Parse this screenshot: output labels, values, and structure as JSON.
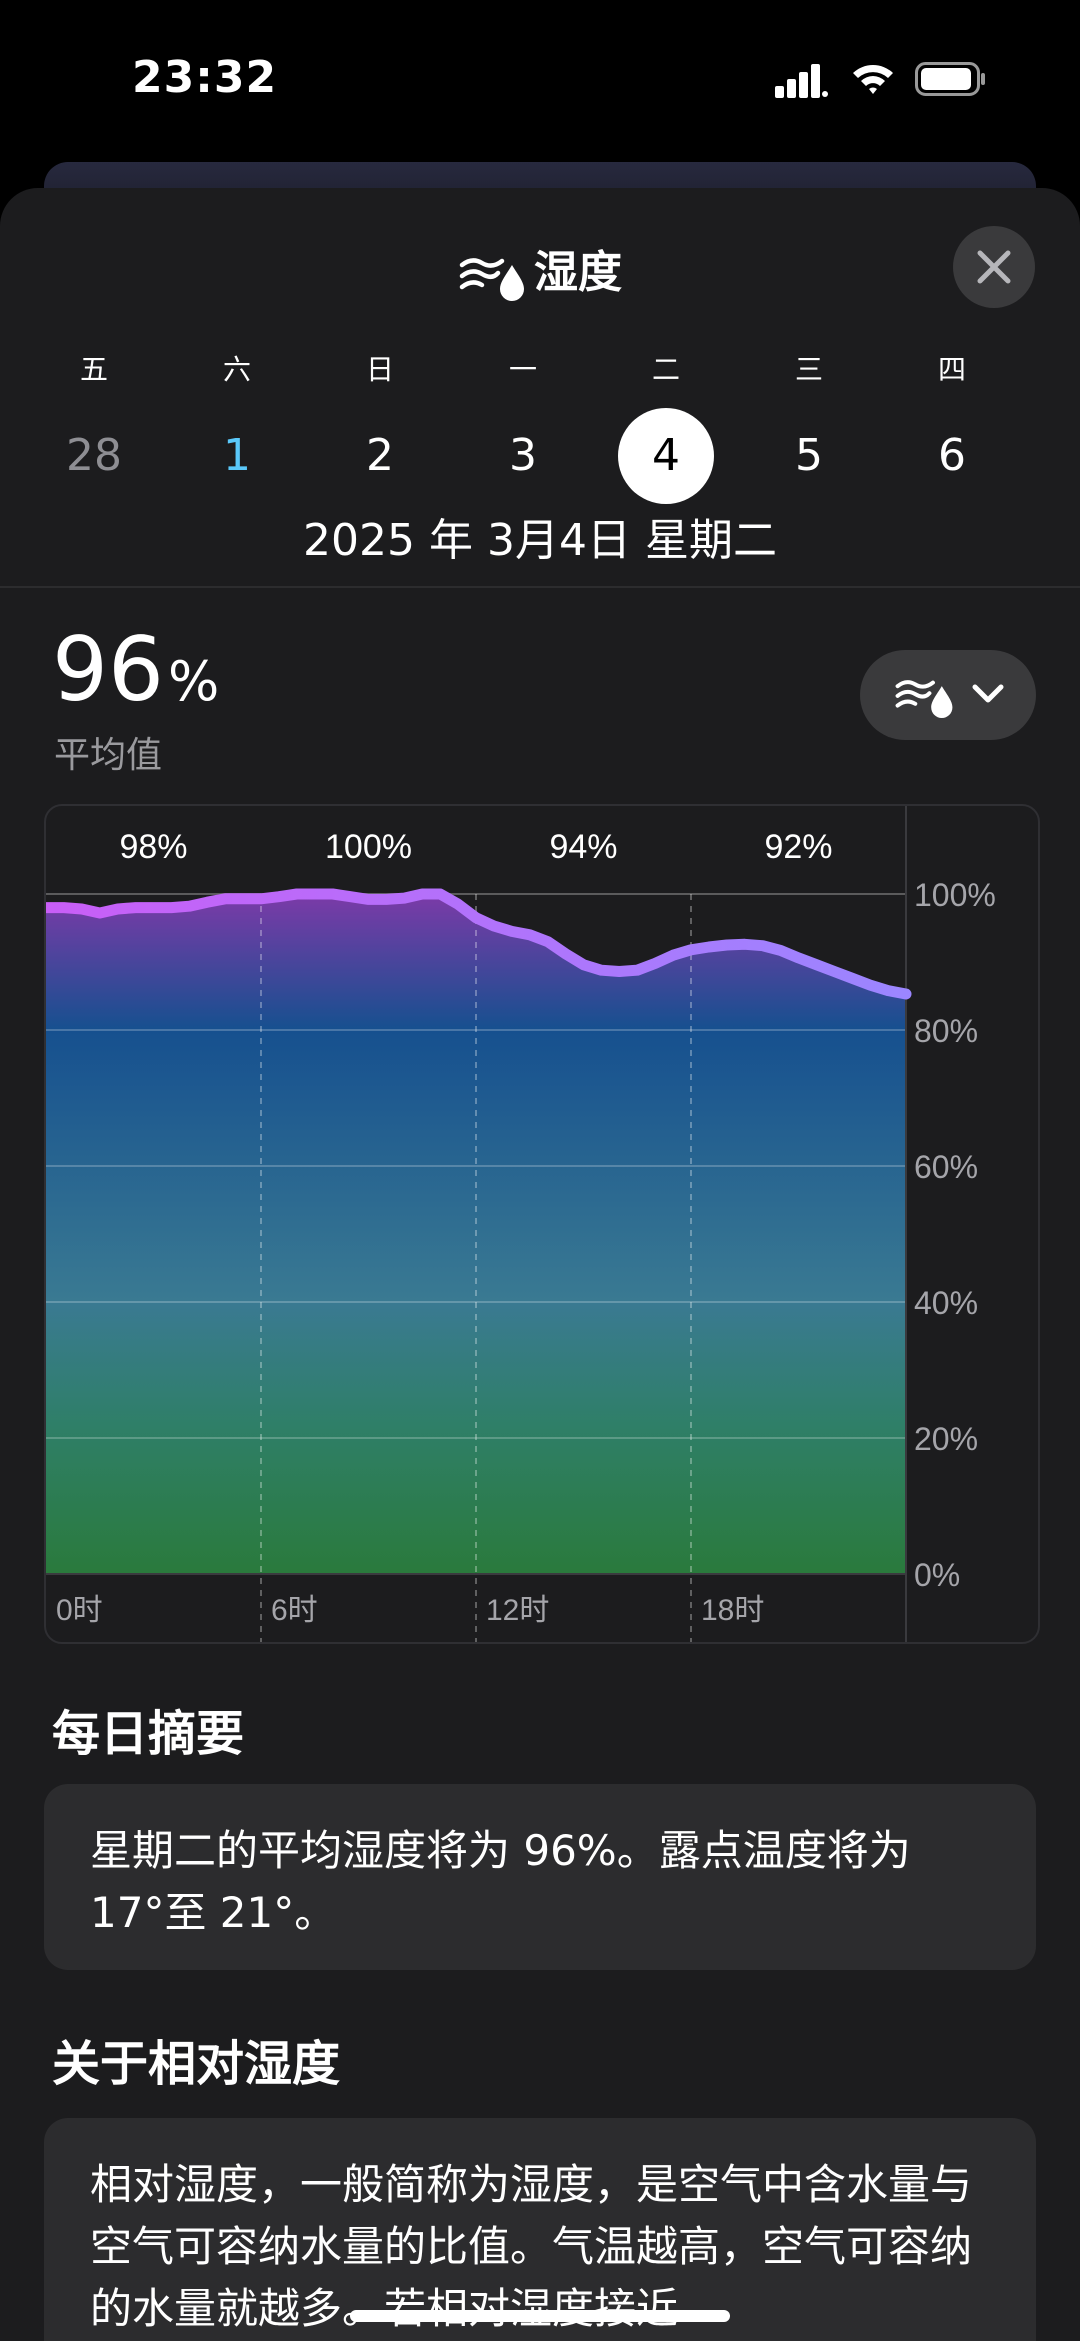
{
  "status": {
    "time": "23:32"
  },
  "header": {
    "title": "湿度",
    "title_icon": "humidity-icon",
    "close_icon": "close-icon"
  },
  "week": [
    {
      "weekday": "五",
      "date": "28",
      "state": "past"
    },
    {
      "weekday": "六",
      "date": "1",
      "state": "today"
    },
    {
      "weekday": "日",
      "date": "2",
      "state": "normal"
    },
    {
      "weekday": "一",
      "date": "3",
      "state": "normal"
    },
    {
      "weekday": "二",
      "date": "4",
      "state": "selected"
    },
    {
      "weekday": "三",
      "date": "5",
      "state": "normal"
    },
    {
      "weekday": "四",
      "date": "6",
      "state": "normal"
    }
  ],
  "selected_date": "2025 年 3月4日 星期二",
  "summary_value": {
    "value": "96",
    "unit": "%",
    "label": "平均值"
  },
  "metric_selector": {
    "icon": "humidity-icon",
    "chevron": "chevron-down-icon"
  },
  "chart_data": {
    "type": "area",
    "x_ticks": [
      "0时",
      "6时",
      "12时",
      "18时"
    ],
    "y_ticks": [
      "100%",
      "80%",
      "60%",
      "40%",
      "20%",
      "0%"
    ],
    "ylim": [
      0,
      100
    ],
    "xlim": [
      0,
      24
    ],
    "block_labels": [
      "98%",
      "100%",
      "94%",
      "92%"
    ],
    "series": [
      {
        "x": [
          0,
          0.5,
          1,
          1.5,
          2,
          2.5,
          3,
          3.5,
          4,
          4.5,
          5,
          5.5,
          6,
          6.5,
          7,
          7.5,
          8,
          8.5,
          9,
          9.5,
          10,
          10.5,
          11,
          11.5,
          12,
          12.5,
          13,
          13.5,
          14,
          14.5,
          15,
          15.5,
          16,
          16.5,
          17,
          17.5,
          18,
          18.5,
          19,
          19.5,
          20,
          20.5,
          21,
          21.5,
          22,
          22.5,
          23,
          23.5,
          24
        ],
        "values": [
          98,
          98,
          97.8,
          97.2,
          97.8,
          98,
          98,
          98,
          98.2,
          98.8,
          99.3,
          99.3,
          99.3,
          99.6,
          100,
          100,
          100,
          99.6,
          99.2,
          99.2,
          99.4,
          100,
          100,
          98.5,
          96.5,
          95.3,
          94.5,
          94,
          93,
          91.2,
          89.6,
          88.8,
          88.6,
          88.8,
          89.8,
          91,
          91.8,
          92.2,
          92.5,
          92.6,
          92.4,
          91.7,
          90.6,
          89.6,
          88.6,
          87.6,
          86.6,
          85.8,
          85.3
        ]
      }
    ],
    "colors": {
      "line_start": "#c95ef7",
      "line_end": "#9b86ff",
      "fill_top": "#7c3aa8",
      "fill_mid": "#16508f",
      "fill_bottom": "#2a7a3c"
    }
  },
  "daily_summary": {
    "heading": "每日摘要",
    "text": "星期二的平均湿度将为 96%。露点温度将为 17°至 21°。"
  },
  "about": {
    "heading": "关于相对湿度",
    "text": "相对湿度，一般简称为湿度，是空气中含水量与空气可容纳水量的比值。气温越高，空气可容纳的水量就越多。若相对湿度接近"
  }
}
